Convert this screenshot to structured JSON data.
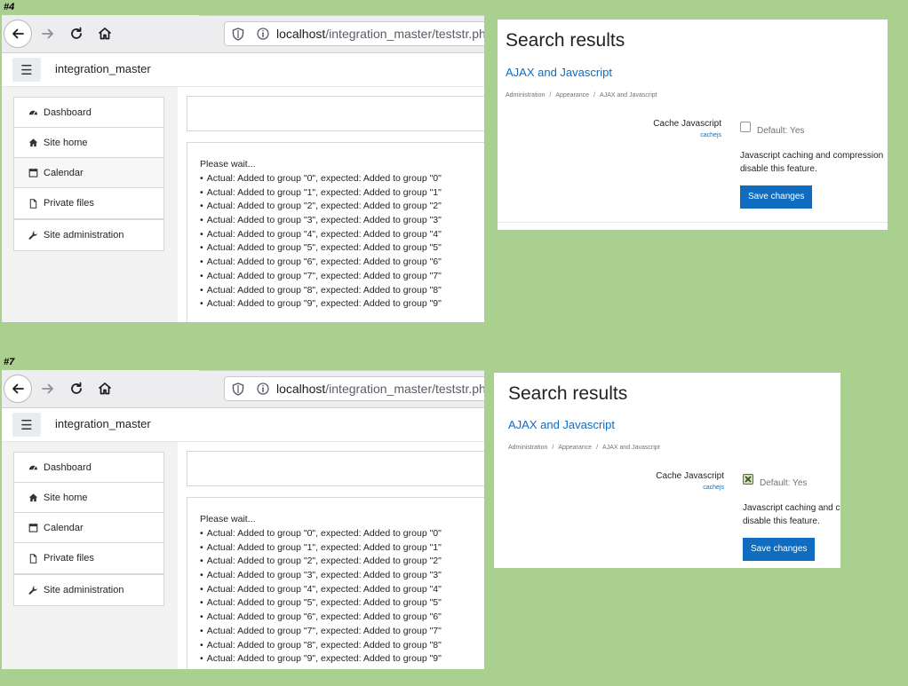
{
  "panels": [
    {
      "label": "#4"
    },
    {
      "label": "#7"
    }
  ],
  "browser": {
    "url_host": "localhost",
    "url_path": "/integration_master/teststr.php",
    "site_name": "integration_master",
    "nav": [
      {
        "label": "Dashboard",
        "icon": "dashboard-icon"
      },
      {
        "label": "Site home",
        "icon": "home-icon"
      },
      {
        "label": "Calendar",
        "icon": "calendar-icon"
      },
      {
        "label": "Private files",
        "icon": "file-icon"
      }
    ],
    "admin": {
      "label": "Site administration",
      "icon": "wrench-icon"
    },
    "wait_text": "Please wait...",
    "results": [
      "Actual: Added to group \"0\", expected: Added to group \"0\"",
      "Actual: Added to group \"1\", expected: Added to group \"1\"",
      "Actual: Added to group \"2\", expected: Added to group \"2\"",
      "Actual: Added to group \"3\", expected: Added to group \"3\"",
      "Actual: Added to group \"4\", expected: Added to group \"4\"",
      "Actual: Added to group \"5\", expected: Added to group \"5\"",
      "Actual: Added to group \"6\", expected: Added to group \"6\"",
      "Actual: Added to group \"7\", expected: Added to group \"7\"",
      "Actual: Added to group \"8\", expected: Added to group \"8\"",
      "Actual: Added to group \"9\", expected: Added to group \"9\""
    ]
  },
  "search": {
    "title": "Search results",
    "link": "AJAX and Javascript",
    "breadcrumb": [
      "Administration",
      "Appearance",
      "AJAX and Javascript"
    ],
    "setting_label": "Cache Javascript",
    "setting_key": "cachejs",
    "default_text": "Default: Yes",
    "description_line1": "Javascript caching and compression",
    "description_line2": "disable this feature.",
    "save_label": "Save changes"
  },
  "search_states": [
    {
      "checked": false
    },
    {
      "checked": true
    }
  ],
  "colors": {
    "background": "#a9d08e",
    "link": "#0f6cbf",
    "button": "#0f6cbf"
  }
}
